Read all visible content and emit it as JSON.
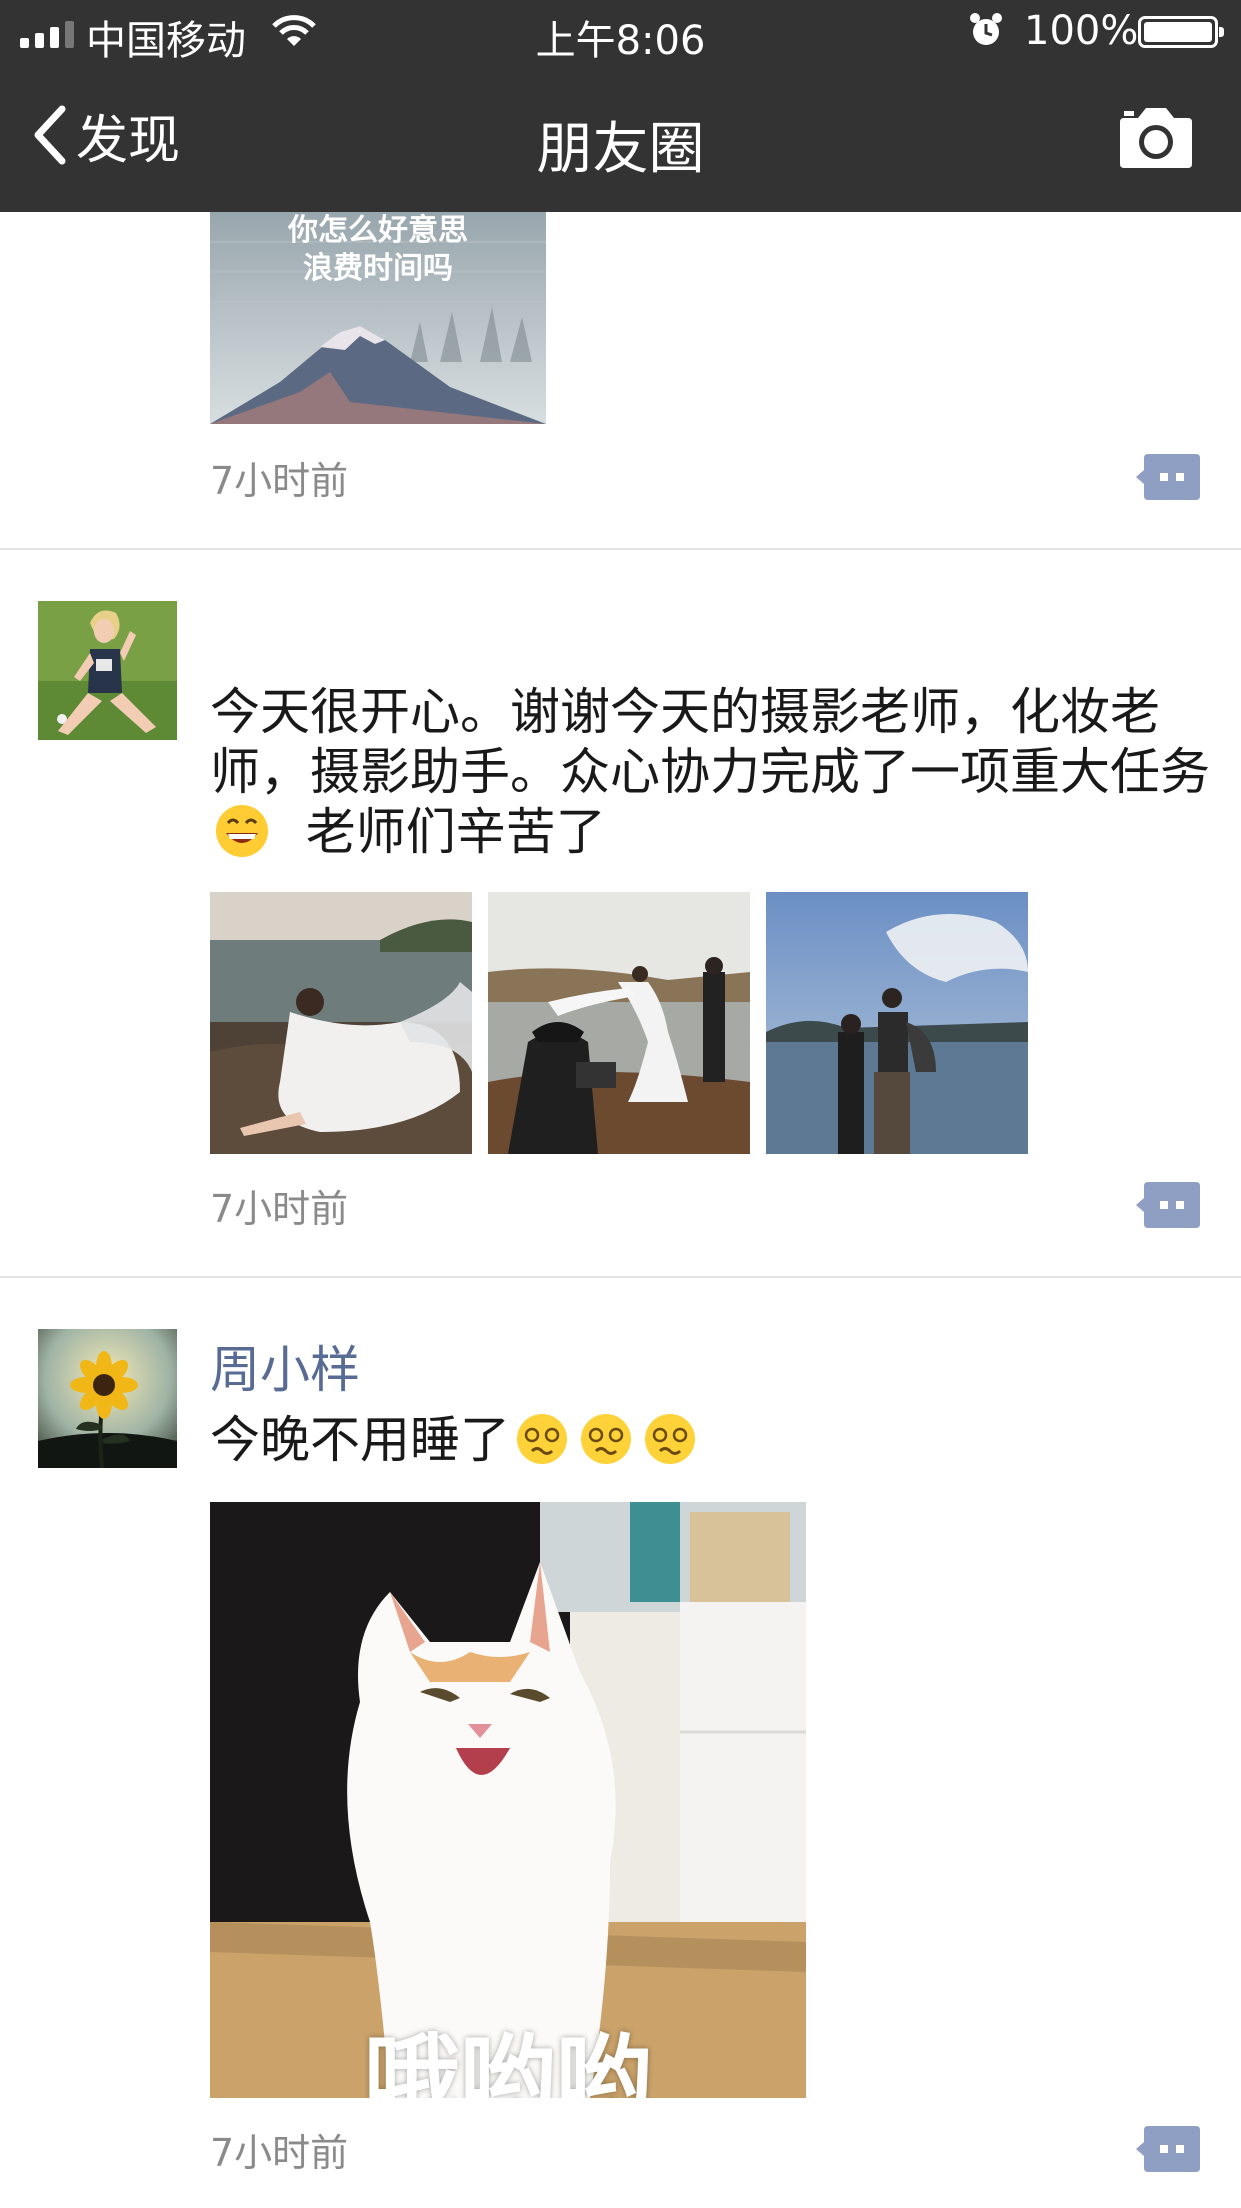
{
  "status_bar": {
    "carrier": "中国移动",
    "time": "上午8:06",
    "battery_percent": "100%",
    "battery_level": 1.0,
    "icons": [
      "signal-icon",
      "wifi-icon",
      "alarm-icon",
      "battery-icon"
    ]
  },
  "nav": {
    "back_label": "发现",
    "title": "朋友圈",
    "back_icon": "chevron-left-icon",
    "camera_icon": "camera-icon"
  },
  "posts": [
    {
      "image_text_lines": [
        "你怎么好意思",
        "浪费时间吗"
      ],
      "time": "7小时前"
    },
    {
      "username": "",
      "text_parts": [
        "今天很开心。谢谢今天的摄影老师，化妆老师，摄影助手。众心协力完成了一项重大任务",
        "老师们辛苦了"
      ],
      "emoji": [
        "grin-emoji"
      ],
      "photos": [
        "bride-on-rocks-photo",
        "photographer-photo",
        "lake-crew-photo"
      ],
      "time": "7小时前"
    },
    {
      "username": "周小样",
      "text": "今晚不用睡了",
      "emoji": [
        "dizzy-emoji",
        "dizzy-emoji",
        "dizzy-emoji"
      ],
      "image_text": "哦哟哟",
      "time": "7小时前"
    }
  ],
  "colors": {
    "bar_bg": "#333333",
    "username": "#576b95",
    "timestamp": "#8a8a8a",
    "comment_icon": "#8e9fc3",
    "divider": "#e3e3e3"
  }
}
